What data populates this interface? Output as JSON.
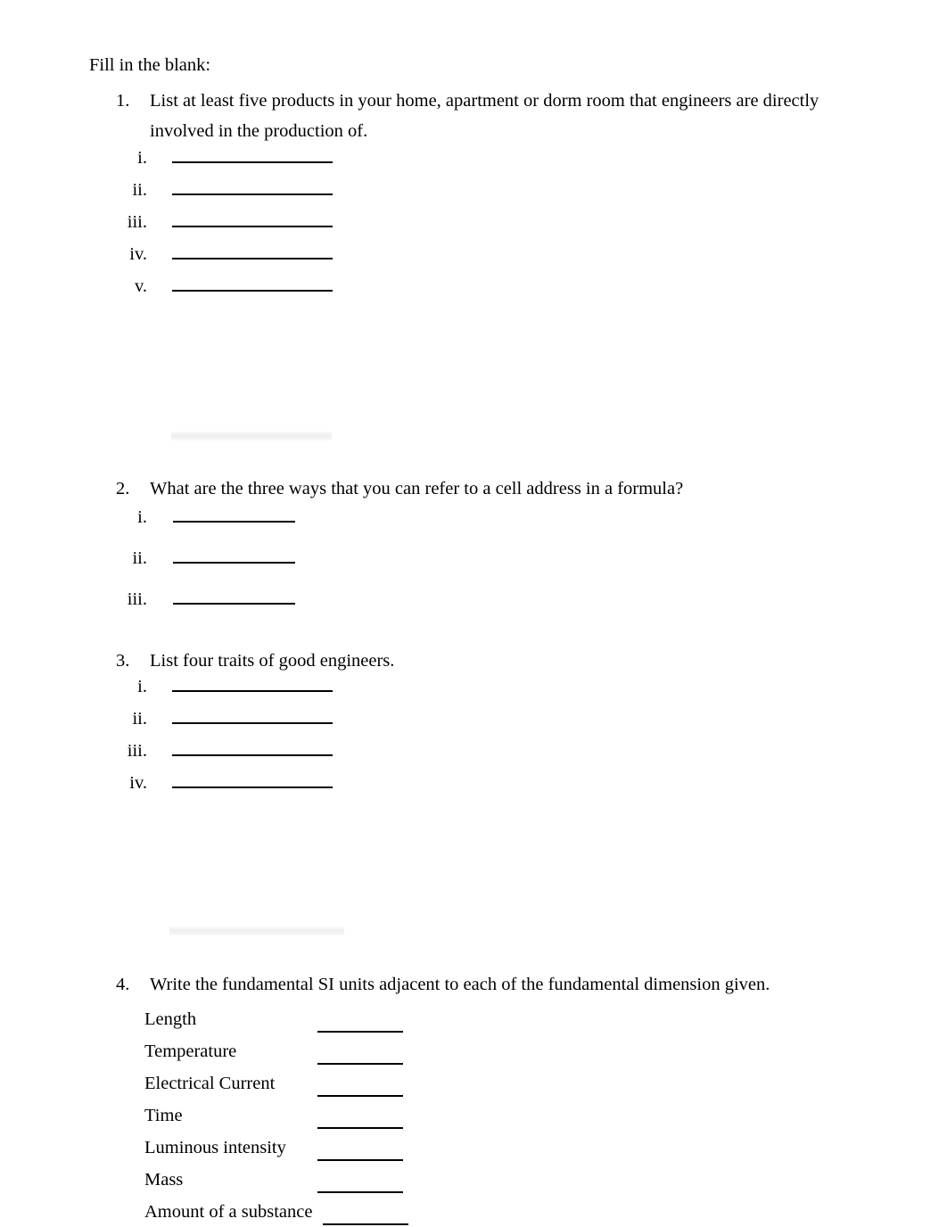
{
  "document": {
    "intro": "Fill in the blank:",
    "questions": [
      {
        "number": "1.",
        "text": "List at least five products in your home, apartment or dorm room that engineers are directly involved in the production of.",
        "answer_style": "tight",
        "answers": [
          {
            "label": "i.",
            "value": ""
          },
          {
            "label": "ii.",
            "value": ""
          },
          {
            "label": "iii.",
            "value": ""
          },
          {
            "label": "iv.",
            "value": ""
          },
          {
            "label": "v.",
            "value": ""
          }
        ]
      },
      {
        "number": "2.",
        "text": "What are the three ways that you can refer to a cell address in a formula?",
        "answer_style": "loose",
        "answers": [
          {
            "label": "i.",
            "value": ""
          },
          {
            "label": "ii.",
            "value": ""
          },
          {
            "label": "iii.",
            "value": ""
          }
        ]
      },
      {
        "number": "3.",
        "text": "List four traits of good engineers.",
        "answer_style": "tight",
        "answers": [
          {
            "label": "i.",
            "value": ""
          },
          {
            "label": "ii.",
            "value": ""
          },
          {
            "label": "iii.",
            "value": ""
          },
          {
            "label": "iv.",
            "value": ""
          }
        ]
      },
      {
        "number": "4.",
        "text": "Write the fundamental SI units adjacent to each of the fundamental dimension given.",
        "answer_style": "si-table",
        "answers": [
          {
            "label": "Length",
            "value": ""
          },
          {
            "label": "Temperature",
            "value": ""
          },
          {
            "label": "Electrical Current",
            "value": ""
          },
          {
            "label": "Time",
            "value": ""
          },
          {
            "label": "Luminous intensity",
            "value": ""
          },
          {
            "label": "Mass",
            "value": ""
          },
          {
            "label": "Amount of a substance",
            "value": ""
          }
        ]
      }
    ]
  }
}
